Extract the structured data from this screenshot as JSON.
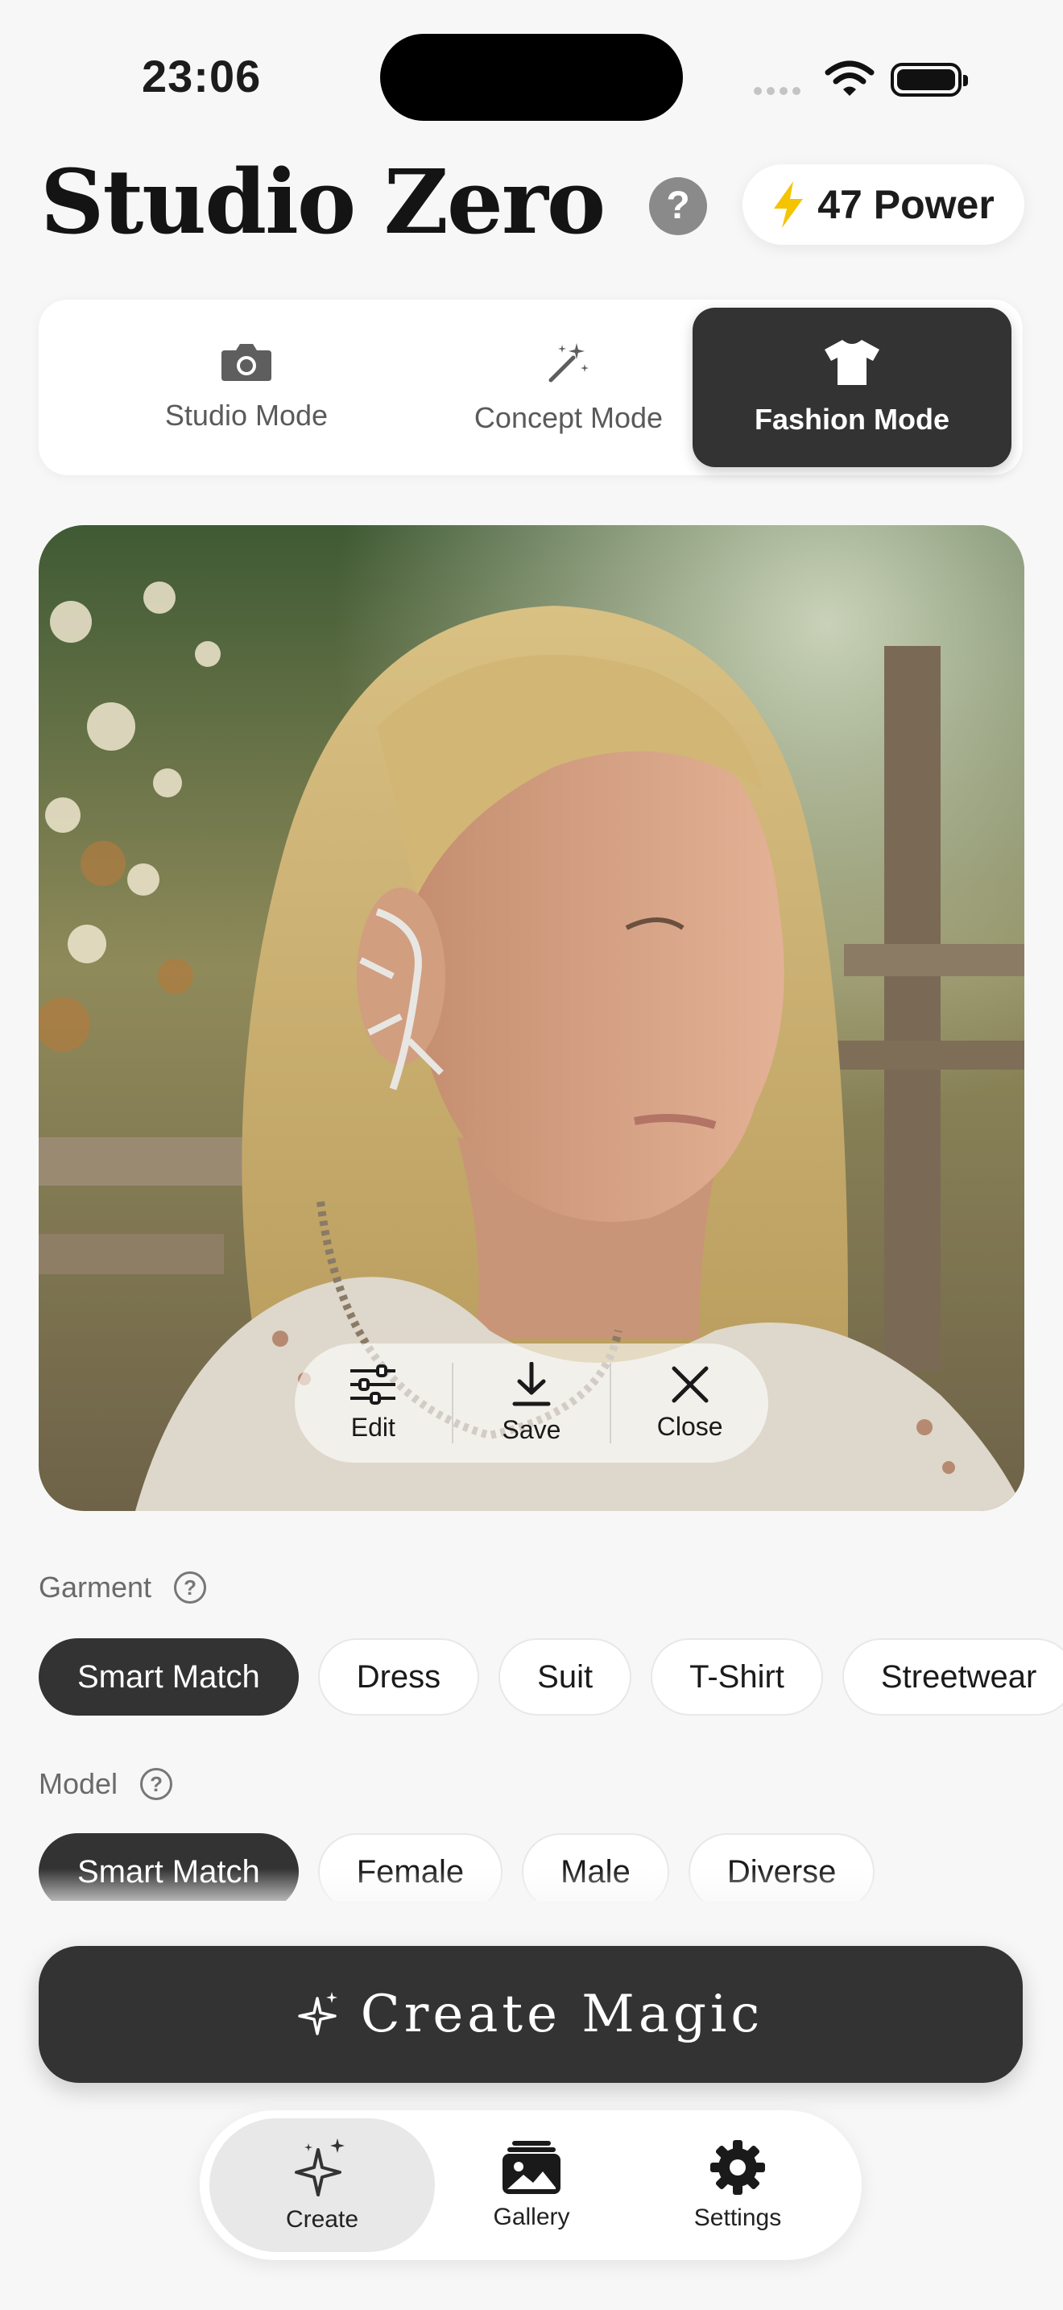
{
  "status": {
    "time": "23:06"
  },
  "header": {
    "title": "Studio Zero",
    "help_label": "?",
    "power_label": "47 Power"
  },
  "modes": [
    {
      "label": "Studio Mode",
      "icon": "camera-icon"
    },
    {
      "label": "Concept Mode",
      "icon": "magic-wand-icon"
    },
    {
      "label": "Fashion Mode",
      "icon": "tshirt-icon",
      "active": true
    }
  ],
  "image_actions": {
    "edit": "Edit",
    "save": "Save",
    "close": "Close"
  },
  "garment": {
    "label": "Garment",
    "options": [
      "Smart Match",
      "Dress",
      "Suit",
      "T-Shirt",
      "Streetwear"
    ],
    "selected": "Smart Match"
  },
  "model": {
    "label": "Model",
    "options": [
      "Smart Match",
      "Female",
      "Male",
      "Diverse"
    ],
    "selected": "Smart Match"
  },
  "create_button": {
    "label": "Create Magic"
  },
  "tabbar": [
    {
      "label": "Create",
      "icon": "sparkles-icon",
      "active": true
    },
    {
      "label": "Gallery",
      "icon": "gallery-icon"
    },
    {
      "label": "Settings",
      "icon": "gear-icon"
    }
  ],
  "colors": {
    "accent": "#333333",
    "power_bolt": "#F5C400",
    "background": "#F7F7F7"
  }
}
